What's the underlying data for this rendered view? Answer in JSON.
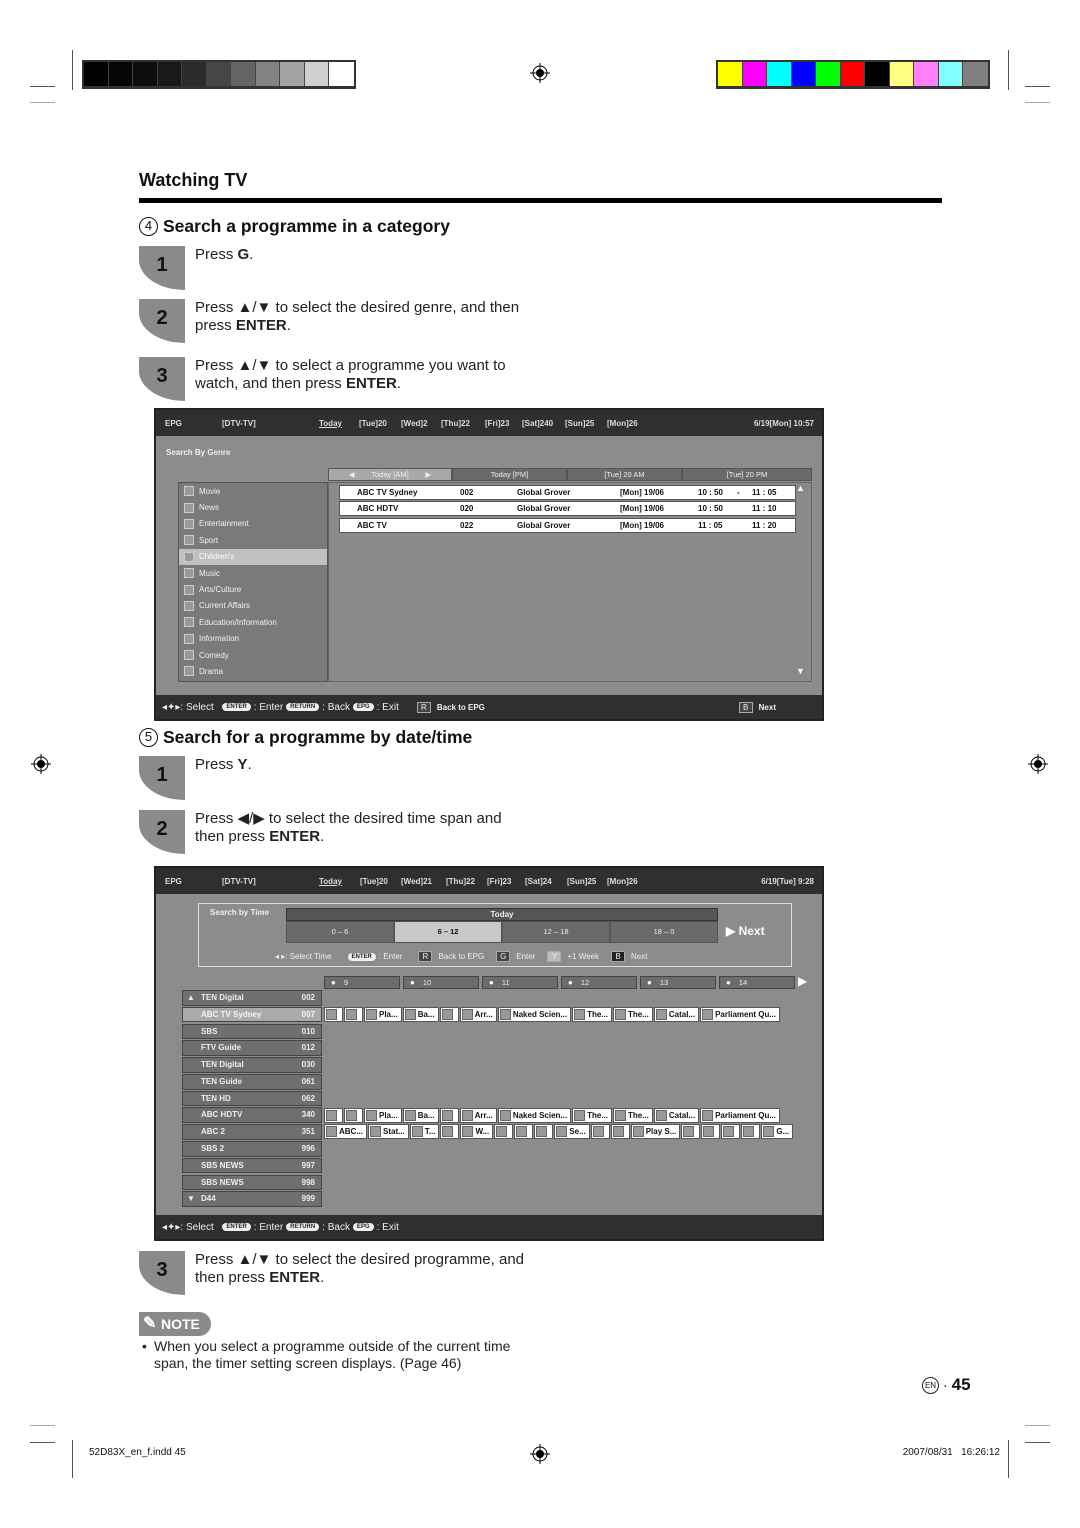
{
  "print_marks": {
    "grayscale_bar": [
      "#000000",
      "#050505",
      "#0d0d0d",
      "#191919",
      "#2b2b2b",
      "#464646",
      "#646464",
      "#838383",
      "#a4a4a4",
      "#cfcfcf",
      "#ffffff"
    ],
    "color_bar": [
      "#ffff00",
      "#ff00ff",
      "#00ffff",
      "#0000ff",
      "#00ff00",
      "#ff0000",
      "#000000",
      "#ffff80",
      "#ff80ff",
      "#80ffff",
      "#808080"
    ]
  },
  "header": {
    "title": "Watching TV"
  },
  "section4": {
    "number": "4",
    "title": "Search a programme in a category",
    "steps": [
      {
        "num": "1",
        "pre": "Press ",
        "key": "G",
        "post": "."
      },
      {
        "num": "2",
        "pre": "Press ▲/▼ to select the desired genre, and then press ",
        "key": "ENTER",
        "post": "."
      },
      {
        "num": "3",
        "pre": "Press ▲/▼ to select a programme you want to watch, and then press ",
        "key": "ENTER",
        "post": "."
      }
    ]
  },
  "epg1": {
    "top": {
      "epg": "EPG",
      "source": "[DTV-TV]",
      "days": [
        "Today",
        "[Tue]20",
        "[Wed]2",
        "[Thu]22",
        "[Fri]23",
        "[Sat]240",
        "[Sun]25",
        "[Mon]26"
      ],
      "datetime": "6/19[Mon]  10:57"
    },
    "panel_label": "Search By Genre",
    "tabs": [
      "Today [AM]",
      "Today [PM]",
      "[Tue] 20 AM",
      "[Tue] 20 PM"
    ],
    "genres": [
      "Movie",
      "News",
      "Entertainment",
      "Sport",
      "Children's",
      "Music",
      "Arts/Culture",
      "Current Affairs",
      "Education/Information",
      "Information",
      "Comedy",
      "Drama"
    ],
    "selected_genre": "Children's",
    "results": [
      {
        "channel": "ABC TV Sydney",
        "num": "002",
        "title": "Global Grover",
        "date": "[Mon] 19/06",
        "start": "10 : 50",
        "dash": "-",
        "end": "11 : 05"
      },
      {
        "channel": "ABC HDTV",
        "num": "020",
        "title": "Global Grover",
        "date": "[Mon] 19/06",
        "start": "10 : 50",
        "dash": "",
        "end": "11 : 10"
      },
      {
        "channel": "ABC TV",
        "num": "022",
        "title": "Global Grover",
        "date": "[Mon] 19/06",
        "start": "11 : 05",
        "dash": "",
        "end": "11 : 20"
      }
    ],
    "bottom": {
      "select": ": Select",
      "enter_key": "ENTER",
      "enter": ": Enter",
      "return_key": "RETURN",
      "back": ": Back",
      "epg_key": "EPG",
      "exit": ": Exit",
      "r_key": "R",
      "back_to_epg": "Back to EPG",
      "b_key": "B",
      "next": "Next"
    }
  },
  "section5": {
    "number": "5",
    "title": "Search for a programme by date/time",
    "steps": [
      {
        "num": "1",
        "pre": "Press ",
        "key": "Y",
        "post": "."
      },
      {
        "num": "2",
        "pre": "Press ◀/▶ to select the desired time span and then press ",
        "key": "ENTER",
        "post": "."
      },
      {
        "num": "3",
        "pre": "Press ▲/▼ to select the desired programme, and then press ",
        "key": "ENTER",
        "post": "."
      }
    ]
  },
  "epg2": {
    "top": {
      "epg": "EPG",
      "source": "[DTV-TV]",
      "days": [
        "Today",
        "[Tue]20",
        "[Wed]21",
        "[Thu]22",
        "[Fri]23",
        "[Sat]24",
        "[Sun]25",
        "[Mon]26"
      ],
      "datetime": "6/19[Tue]  9:28"
    },
    "panel_label": "Search by Time",
    "day_label": "Today",
    "spans": [
      "0 – 6",
      "6 – 12",
      "12 – 18",
      "18 – 0"
    ],
    "selected_span": "6 – 12",
    "next_label": "▶ Next",
    "hint": {
      "select_time": ": Select Time",
      "enter_key": "ENTER",
      "enter": ": Enter",
      "r_key": "R",
      "back_to_epg": "Back to EPG",
      "g_key": "G",
      "g_enter": "Enter",
      "y_key": "Y",
      "week": "+1 Week",
      "b_key": "B",
      "next": "Next"
    },
    "hours": [
      "9",
      "10",
      "11",
      "12",
      "13",
      "14"
    ],
    "channels": [
      {
        "name": "TEN Digital",
        "num": "002",
        "arrow": "▲"
      },
      {
        "name": "ABC TV Sydney",
        "num": "007",
        "selected": true
      },
      {
        "name": "SBS",
        "num": "010"
      },
      {
        "name": "FTV Guide",
        "num": "012"
      },
      {
        "name": "TEN Digital",
        "num": "030"
      },
      {
        "name": "TEN Guide",
        "num": "061"
      },
      {
        "name": "TEN HD",
        "num": "062"
      },
      {
        "name": "ABC HDTV",
        "num": "340"
      },
      {
        "name": "ABC 2",
        "num": "351"
      },
      {
        "name": "SBS 2",
        "num": "996"
      },
      {
        "name": "SBS NEWS",
        "num": "997"
      },
      {
        "name": "SBS NEWS",
        "num": "998"
      },
      {
        "name": "D44",
        "num": "999",
        "arrow": "▼"
      }
    ],
    "programme_rows": [
      {
        "channel_index": 1,
        "items": [
          "",
          "",
          "Pla...",
          "Ba...",
          "",
          "Arr...",
          "Naked Scien...",
          "The...",
          "The...",
          "Catal...",
          "Parliament Qu..."
        ]
      },
      {
        "channel_index": 7,
        "items": [
          "",
          "",
          "Pla...",
          "Ba...",
          "",
          "Arr...",
          "Naked Scien...",
          "The...",
          "The...",
          "Catal...",
          "Parliament Qu..."
        ]
      },
      {
        "channel_index": 8,
        "items": [
          "ABC...",
          "Stat...",
          "T...",
          "",
          "W...",
          "",
          "",
          "",
          "Se...",
          "",
          "",
          "Play S...",
          "",
          "",
          "",
          "",
          "G..."
        ]
      }
    ],
    "bottom": {
      "select": ": Select",
      "enter_key": "ENTER",
      "enter": ": Enter",
      "return_key": "RETURN",
      "back": ": Back",
      "epg_key": "EPG",
      "exit": ": Exit"
    }
  },
  "note": {
    "label": "NOTE",
    "text": "When you select a programme outside of the current time span, the timer setting screen displays. (Page 46)"
  },
  "footer": {
    "lang": "EN",
    "page": "45",
    "file": "52D83X_en_f.indd  45",
    "timestamp": "2007/08/31   16:26:12"
  }
}
